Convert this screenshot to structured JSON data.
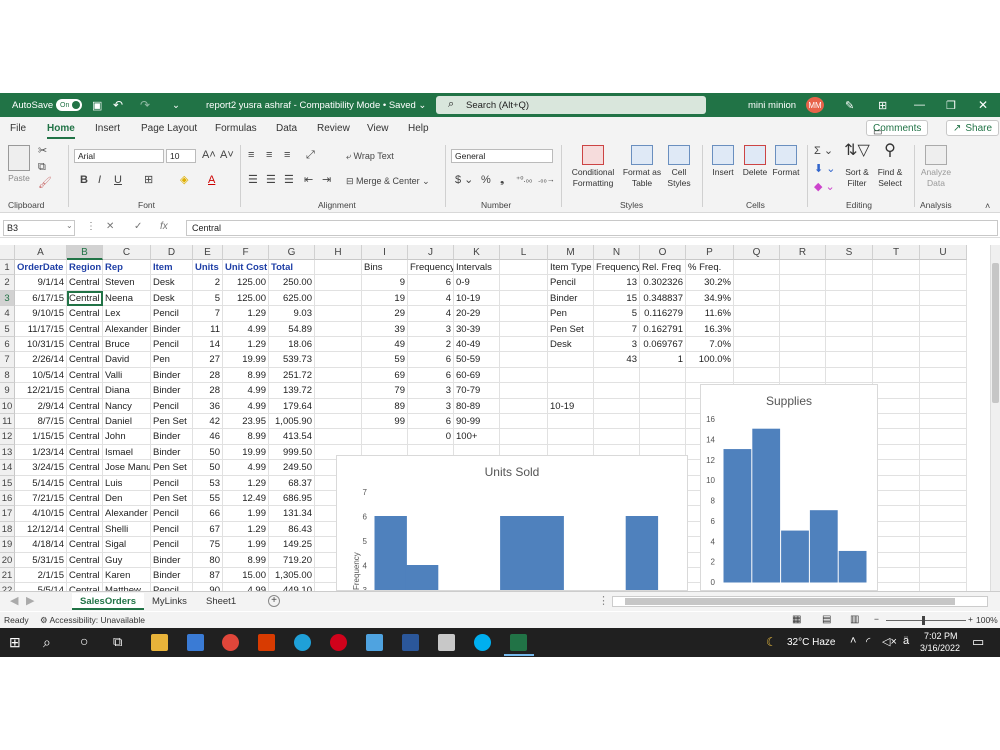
{
  "titlebar": {
    "autosave": "AutoSave",
    "toggle": "On",
    "filename": "report2 yusra ashraf  -  Compatibility Mode  •  Saved  ⌄",
    "search": "Search (Alt+Q)",
    "user": "mini minion",
    "initials": "MM"
  },
  "menu": {
    "items": [
      "File",
      "Home",
      "Insert",
      "Page Layout",
      "Formulas",
      "Data",
      "Review",
      "View",
      "Help"
    ],
    "comments": "Comments",
    "share": "Share"
  },
  "ribbon": {
    "clipboard": "Clipboard",
    "paste": "Paste",
    "font_group": "Font",
    "font_name": "Arial",
    "font_size": "10",
    "alignment": "Alignment",
    "wrap": "Wrap Text",
    "merge": "Merge & Center",
    "number": "Number",
    "number_format": "General",
    "styles": "Styles",
    "conditional": "Conditional\nFormatting",
    "format_table": "Format as\nTable",
    "cell_styles": "Cell\nStyles",
    "cells": "Cells",
    "insert": "Insert",
    "delete": "Delete",
    "format": "Format",
    "editing": "Editing",
    "sort": "Sort &\nFilter",
    "find": "Find &\nSelect",
    "analysis": "Analysis",
    "analyze": "Analyze\nData"
  },
  "formula": {
    "namebox": "B3",
    "value": "Central"
  },
  "columns": [
    "A",
    "B",
    "C",
    "D",
    "E",
    "F",
    "G",
    "H",
    "I",
    "J",
    "K",
    "L",
    "M",
    "N",
    "O",
    "P",
    "Q",
    "R",
    "S",
    "T",
    "U"
  ],
  "rows": [
    [
      "OrderDate",
      "Region",
      "Rep",
      "Item",
      "Units",
      "Unit Cost",
      "Total",
      "",
      "Bins",
      "Frequency",
      "Intervals",
      "",
      "Item Type",
      "Frequency",
      "Rel. Freq",
      "% Freq."
    ],
    [
      "9/1/14",
      "Central",
      "Steven",
      "Desk",
      "2",
      "125.00",
      "250.00",
      "",
      "9",
      "6",
      "0-9",
      "",
      "Pencil",
      "13",
      "0.302326",
      "30.2%"
    ],
    [
      "6/17/15",
      "Central",
      "Neena",
      "Desk",
      "5",
      "125.00",
      "625.00",
      "",
      "19",
      "4",
      "10-19",
      "",
      "Binder",
      "15",
      "0.348837",
      "34.9%"
    ],
    [
      "9/10/15",
      "Central",
      "Lex",
      "Pencil",
      "7",
      "1.29",
      "9.03",
      "",
      "29",
      "4",
      "20-29",
      "",
      "Pen",
      "5",
      "0.116279",
      "11.6%"
    ],
    [
      "11/17/15",
      "Central",
      "Alexander",
      "Binder",
      "11",
      "4.99",
      "54.89",
      "",
      "39",
      "3",
      "30-39",
      "",
      "Pen Set",
      "7",
      "0.162791",
      "16.3%"
    ],
    [
      "10/31/15",
      "Central",
      "Bruce",
      "Pencil",
      "14",
      "1.29",
      "18.06",
      "",
      "49",
      "2",
      "40-49",
      "",
      "Desk",
      "3",
      "0.069767",
      "7.0%"
    ],
    [
      "2/26/14",
      "Central",
      "David",
      "Pen",
      "27",
      "19.99",
      "539.73",
      "",
      "59",
      "6",
      "50-59",
      "",
      "",
      "43",
      "1",
      "100.0%"
    ],
    [
      "10/5/14",
      "Central",
      "Valli",
      "Binder",
      "28",
      "8.99",
      "251.72",
      "",
      "69",
      "6",
      "60-69",
      "",
      "",
      "",
      "",
      ""
    ],
    [
      "12/21/15",
      "Central",
      "Diana",
      "Binder",
      "28",
      "4.99",
      "139.72",
      "",
      "79",
      "3",
      "70-79",
      "",
      "",
      "",
      "",
      ""
    ],
    [
      "2/9/14",
      "Central",
      "Nancy",
      "Pencil",
      "36",
      "4.99",
      "179.64",
      "",
      "89",
      "3",
      "80-89",
      "",
      "10-19",
      "",
      "",
      ""
    ],
    [
      "8/7/15",
      "Central",
      "Daniel",
      "Pen Set",
      "42",
      "23.95",
      "1,005.90",
      "",
      "99",
      "6",
      "90-99",
      "",
      "",
      "",
      "",
      ""
    ],
    [
      "1/15/15",
      "Central",
      "John",
      "Binder",
      "46",
      "8.99",
      "413.54",
      "",
      "",
      "0",
      "100+",
      "",
      "",
      "",
      "",
      ""
    ],
    [
      "1/23/14",
      "Central",
      "Ismael",
      "Binder",
      "50",
      "19.99",
      "999.50",
      "",
      "",
      "",
      "",
      "",
      "",
      "",
      "",
      ""
    ],
    [
      "3/24/15",
      "Central",
      "Jose Manu",
      "Pen Set",
      "50",
      "4.99",
      "249.50",
      "",
      "",
      "",
      "",
      "",
      "",
      "",
      "",
      ""
    ],
    [
      "5/14/15",
      "Central",
      "Luis",
      "Pencil",
      "53",
      "1.29",
      "68.37",
      "",
      "",
      "",
      "",
      "",
      "",
      "",
      "",
      ""
    ],
    [
      "7/21/15",
      "Central",
      "Den",
      "Pen Set",
      "55",
      "12.49",
      "686.95",
      "",
      "",
      "",
      "",
      "",
      "",
      "",
      "",
      ""
    ],
    [
      "4/10/15",
      "Central",
      "Alexander",
      "Pencil",
      "66",
      "1.99",
      "131.34",
      "",
      "",
      "",
      "",
      "",
      "",
      "",
      "",
      ""
    ],
    [
      "12/12/14",
      "Central",
      "Shelli",
      "Pencil",
      "67",
      "1.29",
      "86.43",
      "",
      "",
      "",
      "",
      "",
      "",
      "",
      "",
      ""
    ],
    [
      "4/18/14",
      "Central",
      "Sigal",
      "Pencil",
      "75",
      "1.99",
      "149.25",
      "",
      "",
      "",
      "",
      "",
      "",
      "",
      "",
      ""
    ],
    [
      "5/31/15",
      "Central",
      "Guy",
      "Binder",
      "80",
      "8.99",
      "719.20",
      "",
      "",
      "",
      "",
      "",
      "",
      "",
      "",
      ""
    ],
    [
      "2/1/15",
      "Central",
      "Karen",
      "Binder",
      "87",
      "15.00",
      "1,305.00",
      "",
      "",
      "",
      "",
      "",
      "",
      "",
      "",
      ""
    ],
    [
      "5/5/14",
      "Central",
      "Matthew",
      "Pencil",
      "90",
      "4.99",
      "449.10",
      "",
      "",
      "",
      "",
      "",
      "",
      "",
      "",
      ""
    ]
  ],
  "chart_data": [
    {
      "type": "bar",
      "title": "Units Sold",
      "ylabel": "Frequency",
      "ylim": [
        3,
        7
      ],
      "ticks": [
        3,
        4,
        5,
        6,
        7
      ],
      "values": [
        6,
        4,
        3,
        2,
        6,
        6,
        3,
        3,
        6,
        0
      ],
      "categories": [
        "0-9",
        "10-19",
        "20-29",
        "30-39",
        "40-49",
        "50-59",
        "60-69",
        "70-79",
        "80-89",
        "90-99"
      ]
    },
    {
      "type": "bar",
      "title": "Supplies",
      "ylim": [
        0,
        16
      ],
      "ticks": [
        0,
        2,
        4,
        6,
        8,
        10,
        12,
        14,
        16
      ],
      "categories": [
        "Pencil",
        "Binder",
        "Pen",
        "Pen Set",
        "Desk"
      ],
      "values": [
        13,
        15,
        5,
        7,
        3
      ]
    }
  ],
  "tabs": [
    "SalesOrders",
    "MyLinks",
    "Sheet1"
  ],
  "status": {
    "ready": "Ready",
    "accessibility": "Accessibility: Unavailable",
    "zoom": "100%"
  },
  "taskbar": {
    "weather": "32°C  Haze",
    "time": "7:02 PM",
    "date": "3/16/2022"
  },
  "colors": {
    "excel_green": "#217346",
    "bar": "#4f81bd",
    "header_text": "#1f3fa6"
  }
}
